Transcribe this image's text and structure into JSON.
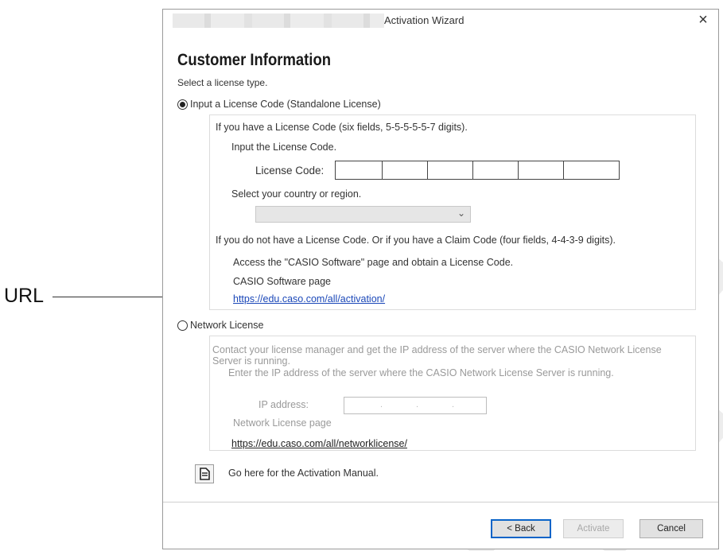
{
  "callout": {
    "label": "URL"
  },
  "window": {
    "title": "Activation Wizard",
    "close_symbol": "×"
  },
  "heading": "Customer Information",
  "select_type_label": "Select a license type.",
  "standalone": {
    "label": "Input a License Code (Standalone License)",
    "checked": true,
    "have_code_text": "If you have a License Code (six fields, 5-5-5-5-5-7 digits).",
    "input_code_text": "Input the License Code.",
    "code_label": "License Code:",
    "code_fields": [
      "",
      "",
      "",
      "",
      "",
      ""
    ],
    "country_label": "Select your country or region.",
    "country_value": "",
    "no_code_text": "If you do not have a License Code. Or if you have a Claim Code (four fields, 4-4-3-9 digits).",
    "access_text": "Access the \"CASIO Software\" page and obtain a License Code.",
    "page_label": "CASIO Software page",
    "url": "https://edu.caso.com/all/activation/"
  },
  "network": {
    "label": "Network License",
    "checked": false,
    "contact_text_line1": "Contact your license manager and get the IP address of the server where the CASIO Network License",
    "contact_text_line2": "Server is running.",
    "enter_ip_text": "Enter the IP address of the server where the CASIO Network License Server is running.",
    "ip_label": "IP address:",
    "ip_value": "",
    "page_label": "Network License page",
    "url": "https://edu.caso.com/all/networklicense/"
  },
  "manual": {
    "text": "Go here for the Activation Manual.",
    "icon": "document-icon"
  },
  "buttons": {
    "back": "< Back",
    "activate": "Activate",
    "cancel": "Cancel"
  }
}
